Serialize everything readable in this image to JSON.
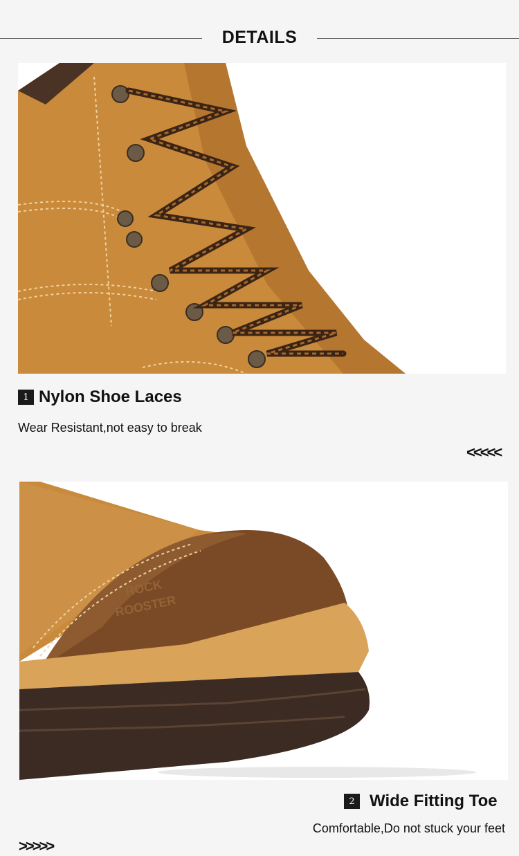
{
  "header": {
    "title": "DETAILS"
  },
  "features": [
    {
      "number": "1",
      "title": "Nylon Shoe Laces",
      "description": "Wear Resistant,not easy to break",
      "arrows": "<<<<<",
      "photo_icon": "boot-laces-photo"
    },
    {
      "number": "2",
      "title": "Wide Fitting Toe",
      "description": "Comfortable,Do not stuck your feet",
      "arrows": ">>>>>",
      "photo_icon": "boot-toe-photo"
    }
  ],
  "brand_emboss": [
    "ROCK",
    "ROOSTER"
  ],
  "colors": {
    "background": "#f5f5f5",
    "leather": "#c98a3c",
    "leather_dark": "#8a5a2b",
    "sole": "#3b2b22",
    "badge": "#1a1a1a"
  }
}
